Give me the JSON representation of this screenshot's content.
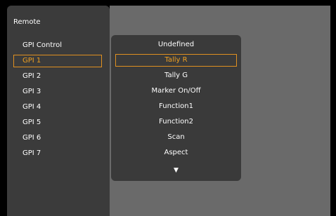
{
  "panel": {
    "title": "Remote",
    "items": [
      {
        "label": "GPI Control",
        "selected": false
      },
      {
        "label": "GPI 1",
        "selected": true
      },
      {
        "label": "GPI 2",
        "selected": false
      },
      {
        "label": "GPI 3",
        "selected": false
      },
      {
        "label": "GPI 4",
        "selected": false
      },
      {
        "label": "GPI 5",
        "selected": false
      },
      {
        "label": "GPI 6",
        "selected": false
      },
      {
        "label": "GPI 7",
        "selected": false
      }
    ]
  },
  "dropdown": {
    "options": [
      {
        "label": "Undefined",
        "selected": false
      },
      {
        "label": "Tally R",
        "selected": true
      },
      {
        "label": "Tally G",
        "selected": false
      },
      {
        "label": "Marker On/Off",
        "selected": false
      },
      {
        "label": "Function1",
        "selected": false
      },
      {
        "label": "Function2",
        "selected": false
      },
      {
        "label": "Scan",
        "selected": false
      },
      {
        "label": "Aspect",
        "selected": false
      }
    ],
    "more_icon": "triangle-down",
    "more_glyph": "▼"
  },
  "colors": {
    "highlight": "#f0a020",
    "panel_bg": "#3b3b3b",
    "area_bg": "#6a6a6a",
    "dropdown_bg": "#3a3a3a",
    "text": "#ffffff"
  }
}
